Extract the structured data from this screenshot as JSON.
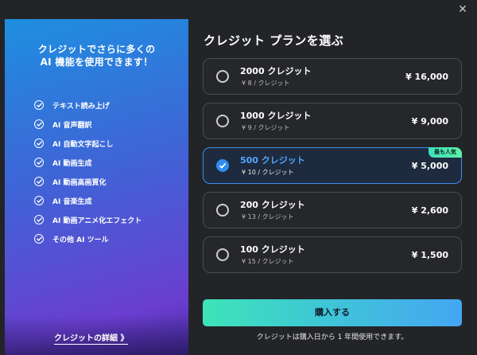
{
  "window": {
    "close_glyph": "✕"
  },
  "left_panel": {
    "title_line1": "クレジットでさらに多くの",
    "title_line2": "AI 機能を使用できます！",
    "features": [
      "テキスト読み上げ",
      "AI 音声翻訳",
      "AI 自動文字起こし",
      "AI 動画生成",
      "AI 動画高画質化",
      "AI 音楽生成",
      "AI 動画アニメ化エフェクト",
      "その他 AI ツール"
    ],
    "details_link": "クレジットの詳細 》"
  },
  "right_panel": {
    "title": "クレジット プランを選ぶ",
    "plans": [
      {
        "name": "2000 クレジット",
        "unit": "¥ 8 / クレジット",
        "price": "¥ 16,000",
        "selected": false,
        "badge": ""
      },
      {
        "name": "1000 クレジット",
        "unit": "¥ 9 / クレジット",
        "price": "¥ 9,000",
        "selected": false,
        "badge": ""
      },
      {
        "name": "500 クレジット",
        "unit": "¥ 10 / クレジット",
        "price": "¥ 5,000",
        "selected": true,
        "badge": "最も人気"
      },
      {
        "name": "200 クレジット",
        "unit": "¥ 13 / クレジット",
        "price": "¥ 2,600",
        "selected": false,
        "badge": ""
      },
      {
        "name": "100 クレジット",
        "unit": "¥ 15 / クレジット",
        "price": "¥ 1,500",
        "selected": false,
        "badge": ""
      }
    ],
    "buy_button": "購入する",
    "validity_note": "クレジットは購入日から 1 年間使用できます。"
  },
  "colors": {
    "accent": "#3d8df0",
    "badge": "#4ee8b4",
    "button_start": "#3de4b8",
    "button_end": "#45a6f2"
  }
}
